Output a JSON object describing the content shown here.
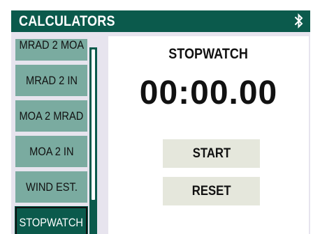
{
  "header": {
    "title": "CALCULATORS",
    "status_icon": "bluetooth-icon"
  },
  "menu": {
    "items": [
      {
        "label": "MRAD 2 MOA",
        "active": false
      },
      {
        "label": "MRAD 2 IN",
        "active": false
      },
      {
        "label": "MOA 2 MRAD",
        "active": false
      },
      {
        "label": "MOA 2 IN",
        "active": false
      },
      {
        "label": "WIND EST.",
        "active": false
      },
      {
        "label": "STOPWATCH",
        "active": true
      }
    ]
  },
  "stopwatch": {
    "title": "STOPWATCH",
    "time": "00:00.00",
    "start_label": "START",
    "reset_label": "RESET"
  },
  "colors": {
    "brand": "#0b5a4c",
    "menu_item": "#7aaba0",
    "panel_background": "#e7e4ee",
    "button_background": "#e5e7dc"
  }
}
